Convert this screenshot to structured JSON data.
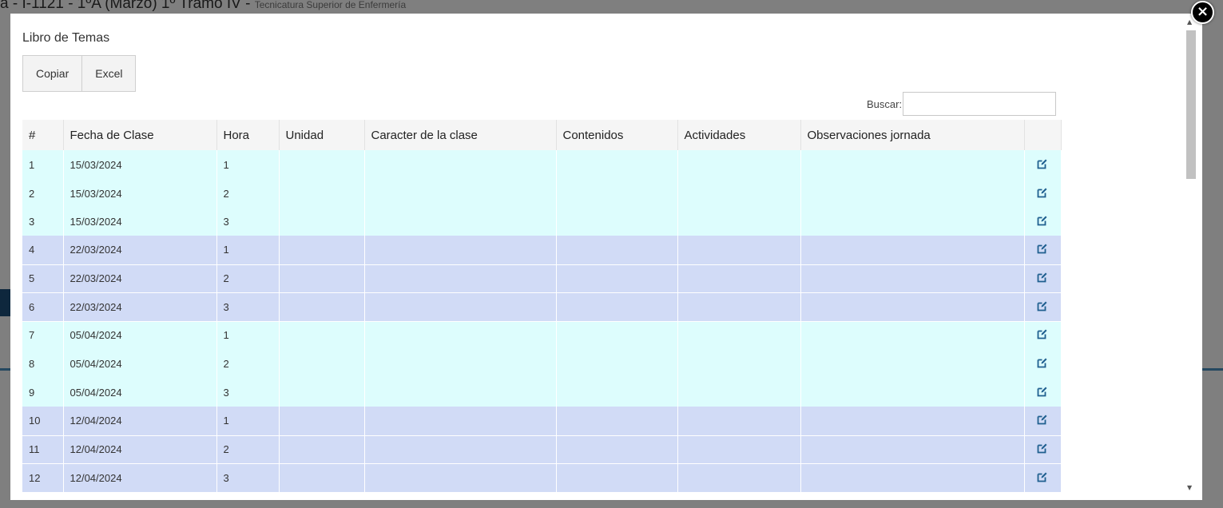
{
  "background": {
    "title": "a - I-1121 - 1ºA (Marzo) 1º Tramo IV -",
    "subtitle": "Tecnicatura Superior de Enfermería"
  },
  "modal": {
    "title": "Libro de Temas",
    "buttons": {
      "copy": "Copiar",
      "excel": "Excel"
    },
    "search": {
      "label": "Buscar:",
      "value": ""
    },
    "close_symbol": "×"
  },
  "table": {
    "headers": [
      "#",
      "Fecha de Clase",
      "Hora",
      "Unidad",
      "Caracter de la clase",
      "Contenidos",
      "Actividades",
      "Observaciones jornada",
      ""
    ],
    "rows": [
      {
        "n": "1",
        "fecha": "15/03/2024",
        "hora": "1"
      },
      {
        "n": "2",
        "fecha": "15/03/2024",
        "hora": "2"
      },
      {
        "n": "3",
        "fecha": "15/03/2024",
        "hora": "3"
      },
      {
        "n": "4",
        "fecha": "22/03/2024",
        "hora": "1"
      },
      {
        "n": "5",
        "fecha": "22/03/2024",
        "hora": "2"
      },
      {
        "n": "6",
        "fecha": "22/03/2024",
        "hora": "3"
      },
      {
        "n": "7",
        "fecha": "05/04/2024",
        "hora": "1"
      },
      {
        "n": "8",
        "fecha": "05/04/2024",
        "hora": "2"
      },
      {
        "n": "9",
        "fecha": "05/04/2024",
        "hora": "3"
      },
      {
        "n": "10",
        "fecha": "12/04/2024",
        "hora": "1"
      },
      {
        "n": "11",
        "fecha": "12/04/2024",
        "hora": "2"
      },
      {
        "n": "12",
        "fecha": "12/04/2024",
        "hora": "3"
      }
    ],
    "row_icon": "edit-icon"
  },
  "colors": {
    "odd_group": "#ddfdfd",
    "even_group": "#d1dbf6",
    "icon": "#1f5f8f"
  }
}
